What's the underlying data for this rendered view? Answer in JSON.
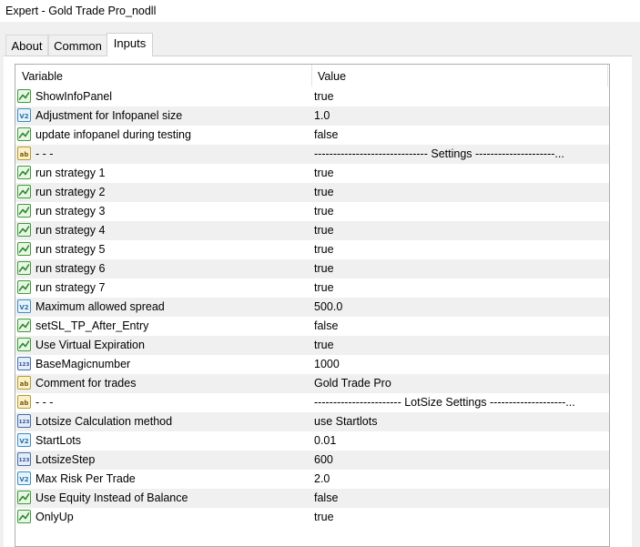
{
  "window": {
    "title": "Expert - Gold Trade Pro_nodll"
  },
  "tabs": [
    {
      "label": "About"
    },
    {
      "label": "Common"
    },
    {
      "label": "Inputs",
      "active": true
    }
  ],
  "table": {
    "columns": {
      "variable": "Variable",
      "value": "Value"
    },
    "rows": [
      {
        "icon": "bool-icon",
        "variable": "ShowInfoPanel",
        "value": "true"
      },
      {
        "icon": "double-icon",
        "variable": "Adjustment for Infopanel size",
        "value": "1.0"
      },
      {
        "icon": "bool-icon",
        "variable": "update infopanel during testing",
        "value": "false"
      },
      {
        "icon": "string-icon",
        "variable": "- - -",
        "value": "------------------------------ Settings ---------------------..."
      },
      {
        "icon": "bool-icon",
        "variable": "run strategy 1",
        "value": "true"
      },
      {
        "icon": "bool-icon",
        "variable": "run strategy 2",
        "value": "true"
      },
      {
        "icon": "bool-icon",
        "variable": "run strategy 3",
        "value": "true"
      },
      {
        "icon": "bool-icon",
        "variable": "run strategy 4",
        "value": "true"
      },
      {
        "icon": "bool-icon",
        "variable": "run strategy 5",
        "value": "true"
      },
      {
        "icon": "bool-icon",
        "variable": "run strategy 6",
        "value": "true"
      },
      {
        "icon": "bool-icon",
        "variable": "run strategy 7",
        "value": "true"
      },
      {
        "icon": "double-icon",
        "variable": "Maximum allowed spread",
        "value": "500.0"
      },
      {
        "icon": "bool-icon",
        "variable": "setSL_TP_After_Entry",
        "value": "false"
      },
      {
        "icon": "bool-icon",
        "variable": "Use Virtual Expiration",
        "value": "true"
      },
      {
        "icon": "int-icon",
        "variable": "BaseMagicnumber",
        "value": "1000"
      },
      {
        "icon": "string-icon",
        "variable": "Comment for trades",
        "value": "Gold Trade Pro"
      },
      {
        "icon": "string-icon",
        "variable": "- - -",
        "value": "----------------------- LotSize Settings --------------------..."
      },
      {
        "icon": "int-icon",
        "variable": "Lotsize Calculation method",
        "value": "use Startlots"
      },
      {
        "icon": "double-icon",
        "variable": "StartLots",
        "value": "0.01"
      },
      {
        "icon": "int-icon",
        "variable": "LotsizeStep",
        "value": "600"
      },
      {
        "icon": "double-icon",
        "variable": "Max Risk Per Trade",
        "value": "2.0"
      },
      {
        "icon": "bool-icon",
        "variable": "Use Equity Instead of Balance",
        "value": "false"
      },
      {
        "icon": "bool-icon",
        "variable": "OnlyUp",
        "value": "true"
      }
    ]
  }
}
